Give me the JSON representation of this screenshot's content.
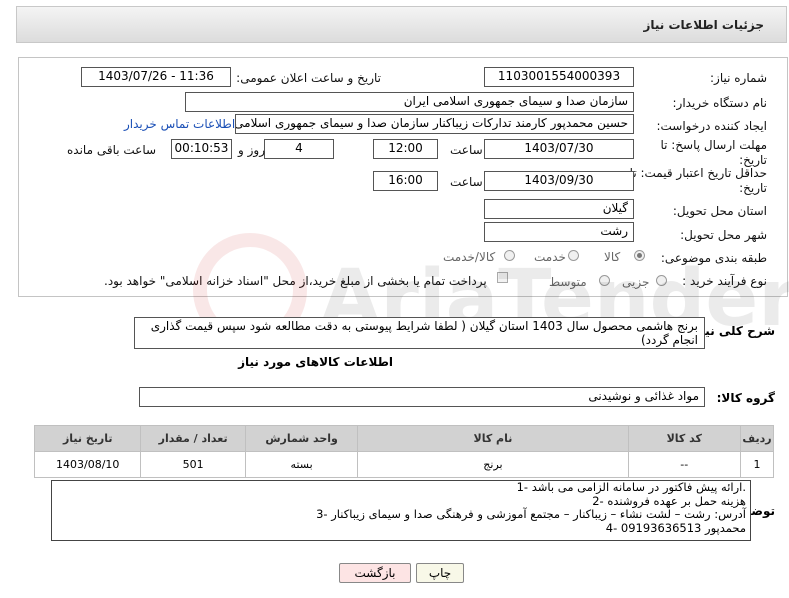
{
  "header": {
    "title": "جزئیات اطلاعات نیاز"
  },
  "form": {
    "need_number": {
      "label": "شماره نیاز:",
      "value": "1103001554000393"
    },
    "announce_datetime": {
      "label": "تاریخ و ساعت اعلان عمومی:",
      "value": "1403/07/26 - 11:36"
    },
    "buyer_org": {
      "label": "نام دستگاه خریدار:",
      "value": "سازمان صدا و سیمای جمهوری اسلامی ایران"
    },
    "requester": {
      "label": "ایجاد کننده درخواست:",
      "value": "حسین محمدپور کارمند تدارکات زیباکنار سازمان صدا و سیمای جمهوری اسلامی",
      "contact_link": "اطلاعات تماس خریدار"
    },
    "reply_deadline": {
      "label": "مهلت ارسال پاسخ: تا تاریخ:",
      "date": "1403/07/30",
      "time_label": "ساعت",
      "time": "12:00",
      "days": "4",
      "days_label": "روز و",
      "remaining": "00:10:53",
      "remaining_label": "ساعت باقی مانده"
    },
    "price_validity": {
      "label": "حداقل تاریخ اعتبار قیمت: تا تاریخ:",
      "date": "1403/09/30",
      "time_label": "ساعت",
      "time": "16:00"
    },
    "delivery_province": {
      "label": "استان محل تحویل:",
      "value": "گیلان"
    },
    "delivery_city": {
      "label": "شهر محل تحویل:",
      "value": "رشت"
    },
    "category": {
      "label": "طبقه بندی موضوعی:",
      "options": [
        "کالا",
        "خدمت",
        "کالا/خدمت"
      ],
      "selected": "کالا"
    },
    "purchase_process": {
      "label": "نوع فرآیند خرید :",
      "options": [
        "جزیی",
        "متوسط"
      ],
      "payment_note": "پرداخت تمام یا بخشی از مبلغ خرید،از محل \"اسناد خزانه اسلامی\" خواهد بود."
    }
  },
  "description": {
    "label": "شرح کلی نیاز:",
    "value": "برنج هاشمی محصول سال 1403 استان گیلان ( لطفا شرایط پیوستی به دقت مطالعه شود سپس قیمت گذاری انجام گردد)"
  },
  "goods_info": {
    "title": "اطلاعات کالاهای مورد نیاز",
    "group_label": "گروه کالا:",
    "group_value": "مواد غذائی و نوشیدنی",
    "table": {
      "headers": [
        "ردیف",
        "کد کالا",
        "نام کالا",
        "واحد شمارش",
        "تعداد / مقدار",
        "تاریخ نیاز"
      ],
      "rows": [
        [
          "1",
          "--",
          "برنج",
          "بسته",
          "501",
          "1403/08/10"
        ]
      ]
    }
  },
  "buyer_notes": {
    "label": "توضیحات خریدار:",
    "lines": [
      "1- ارائه پیش فاکتور در سامانه الزامی می باشد.",
      "2- هزینه حمل بر عهده فروشنده",
      "3- آدرس: رشت – لشت نشاء – زیباکنار – مجتمع آموزشی و فرهنگی صدا و سیمای زیباکنار",
      "4- 09193636513 محمدپور"
    ]
  },
  "buttons": {
    "print": "چاپ",
    "back": "بازگشت"
  },
  "watermark": {
    "text": "AriaTender.neT"
  },
  "colors": {
    "link": "#1a4fb6",
    "back_button_bg": "#fde4e4",
    "print_button_bg": "#f8f8e8"
  }
}
